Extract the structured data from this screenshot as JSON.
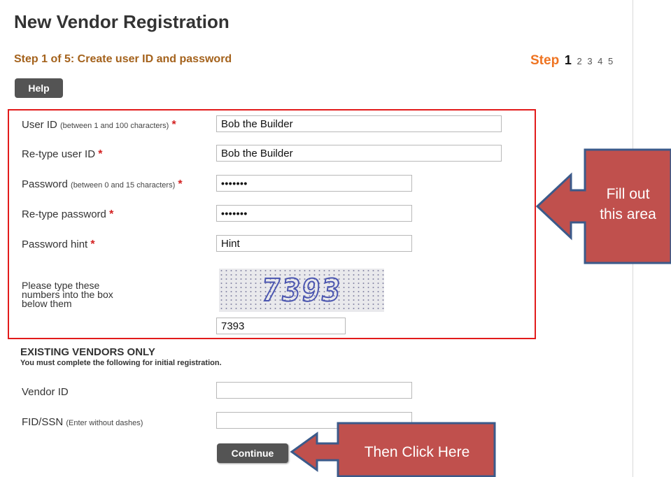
{
  "page": {
    "title": "New Vendor Registration",
    "step_heading": "Step 1 of 5: Create user ID and password",
    "help_label": "Help"
  },
  "stepper": {
    "label": "Step",
    "current": "1",
    "steps": [
      "2",
      "3",
      "4",
      "5"
    ]
  },
  "form": {
    "user_id": {
      "label": "User ID",
      "hint": "(between 1 and 100 characters)",
      "value": "Bob the Builder"
    },
    "retype_user_id": {
      "label": "Re-type user ID",
      "value": "Bob the Builder"
    },
    "password": {
      "label": "Password",
      "hint": "(between 0 and 15 characters)",
      "value": "•••••••"
    },
    "retype_password": {
      "label": "Re-type password",
      "value": "•••••••"
    },
    "password_hint": {
      "label": "Password hint",
      "value": "Hint"
    },
    "captcha": {
      "instruction_1": "Please type these",
      "instruction_2": "numbers into the box",
      "instruction_3": "below them",
      "image_text": "7393",
      "value": "7393"
    },
    "required_marker": "*"
  },
  "existing_vendors": {
    "title": "EXISTING VENDORS ONLY",
    "note": "You must complete the following for initial registration.",
    "vendor_id": {
      "label": "Vendor ID",
      "value": ""
    },
    "fid_ssn": {
      "label": "FID/SSN",
      "hint": "(Enter without dashes)",
      "value": ""
    }
  },
  "continue_label": "Continue",
  "annotations": {
    "fill_line1": "Fill out",
    "fill_line2": "this area",
    "click": "Then Click Here"
  },
  "colors": {
    "accent_orange": "#ef7422",
    "step_heading": "#a4621c",
    "highlight_border": "#e21b1b",
    "callout_fill": "#c0504d",
    "callout_stroke": "#3b5a8a",
    "button": "#545454"
  }
}
